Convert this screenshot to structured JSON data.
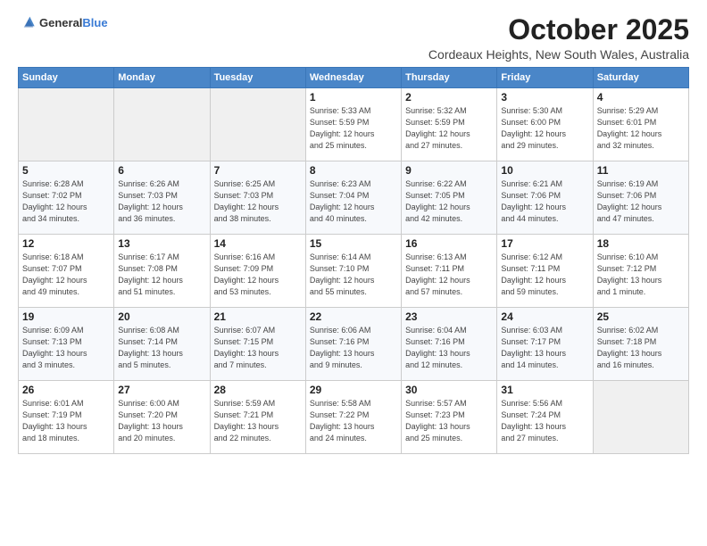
{
  "header": {
    "logo_general": "General",
    "logo_blue": "Blue",
    "title": "October 2025",
    "subtitle": "Cordeaux Heights, New South Wales, Australia"
  },
  "weekdays": [
    "Sunday",
    "Monday",
    "Tuesday",
    "Wednesday",
    "Thursday",
    "Friday",
    "Saturday"
  ],
  "weeks": [
    [
      {
        "day": "",
        "info": ""
      },
      {
        "day": "",
        "info": ""
      },
      {
        "day": "",
        "info": ""
      },
      {
        "day": "1",
        "info": "Sunrise: 5:33 AM\nSunset: 5:59 PM\nDaylight: 12 hours\nand 25 minutes."
      },
      {
        "day": "2",
        "info": "Sunrise: 5:32 AM\nSunset: 5:59 PM\nDaylight: 12 hours\nand 27 minutes."
      },
      {
        "day": "3",
        "info": "Sunrise: 5:30 AM\nSunset: 6:00 PM\nDaylight: 12 hours\nand 29 minutes."
      },
      {
        "day": "4",
        "info": "Sunrise: 5:29 AM\nSunset: 6:01 PM\nDaylight: 12 hours\nand 32 minutes."
      }
    ],
    [
      {
        "day": "5",
        "info": "Sunrise: 6:28 AM\nSunset: 7:02 PM\nDaylight: 12 hours\nand 34 minutes."
      },
      {
        "day": "6",
        "info": "Sunrise: 6:26 AM\nSunset: 7:03 PM\nDaylight: 12 hours\nand 36 minutes."
      },
      {
        "day": "7",
        "info": "Sunrise: 6:25 AM\nSunset: 7:03 PM\nDaylight: 12 hours\nand 38 minutes."
      },
      {
        "day": "8",
        "info": "Sunrise: 6:23 AM\nSunset: 7:04 PM\nDaylight: 12 hours\nand 40 minutes."
      },
      {
        "day": "9",
        "info": "Sunrise: 6:22 AM\nSunset: 7:05 PM\nDaylight: 12 hours\nand 42 minutes."
      },
      {
        "day": "10",
        "info": "Sunrise: 6:21 AM\nSunset: 7:06 PM\nDaylight: 12 hours\nand 44 minutes."
      },
      {
        "day": "11",
        "info": "Sunrise: 6:19 AM\nSunset: 7:06 PM\nDaylight: 12 hours\nand 47 minutes."
      }
    ],
    [
      {
        "day": "12",
        "info": "Sunrise: 6:18 AM\nSunset: 7:07 PM\nDaylight: 12 hours\nand 49 minutes."
      },
      {
        "day": "13",
        "info": "Sunrise: 6:17 AM\nSunset: 7:08 PM\nDaylight: 12 hours\nand 51 minutes."
      },
      {
        "day": "14",
        "info": "Sunrise: 6:16 AM\nSunset: 7:09 PM\nDaylight: 12 hours\nand 53 minutes."
      },
      {
        "day": "15",
        "info": "Sunrise: 6:14 AM\nSunset: 7:10 PM\nDaylight: 12 hours\nand 55 minutes."
      },
      {
        "day": "16",
        "info": "Sunrise: 6:13 AM\nSunset: 7:11 PM\nDaylight: 12 hours\nand 57 minutes."
      },
      {
        "day": "17",
        "info": "Sunrise: 6:12 AM\nSunset: 7:11 PM\nDaylight: 12 hours\nand 59 minutes."
      },
      {
        "day": "18",
        "info": "Sunrise: 6:10 AM\nSunset: 7:12 PM\nDaylight: 13 hours\nand 1 minute."
      }
    ],
    [
      {
        "day": "19",
        "info": "Sunrise: 6:09 AM\nSunset: 7:13 PM\nDaylight: 13 hours\nand 3 minutes."
      },
      {
        "day": "20",
        "info": "Sunrise: 6:08 AM\nSunset: 7:14 PM\nDaylight: 13 hours\nand 5 minutes."
      },
      {
        "day": "21",
        "info": "Sunrise: 6:07 AM\nSunset: 7:15 PM\nDaylight: 13 hours\nand 7 minutes."
      },
      {
        "day": "22",
        "info": "Sunrise: 6:06 AM\nSunset: 7:16 PM\nDaylight: 13 hours\nand 9 minutes."
      },
      {
        "day": "23",
        "info": "Sunrise: 6:04 AM\nSunset: 7:16 PM\nDaylight: 13 hours\nand 12 minutes."
      },
      {
        "day": "24",
        "info": "Sunrise: 6:03 AM\nSunset: 7:17 PM\nDaylight: 13 hours\nand 14 minutes."
      },
      {
        "day": "25",
        "info": "Sunrise: 6:02 AM\nSunset: 7:18 PM\nDaylight: 13 hours\nand 16 minutes."
      }
    ],
    [
      {
        "day": "26",
        "info": "Sunrise: 6:01 AM\nSunset: 7:19 PM\nDaylight: 13 hours\nand 18 minutes."
      },
      {
        "day": "27",
        "info": "Sunrise: 6:00 AM\nSunset: 7:20 PM\nDaylight: 13 hours\nand 20 minutes."
      },
      {
        "day": "28",
        "info": "Sunrise: 5:59 AM\nSunset: 7:21 PM\nDaylight: 13 hours\nand 22 minutes."
      },
      {
        "day": "29",
        "info": "Sunrise: 5:58 AM\nSunset: 7:22 PM\nDaylight: 13 hours\nand 24 minutes."
      },
      {
        "day": "30",
        "info": "Sunrise: 5:57 AM\nSunset: 7:23 PM\nDaylight: 13 hours\nand 25 minutes."
      },
      {
        "day": "31",
        "info": "Sunrise: 5:56 AM\nSunset: 7:24 PM\nDaylight: 13 hours\nand 27 minutes."
      },
      {
        "day": "",
        "info": ""
      }
    ]
  ]
}
